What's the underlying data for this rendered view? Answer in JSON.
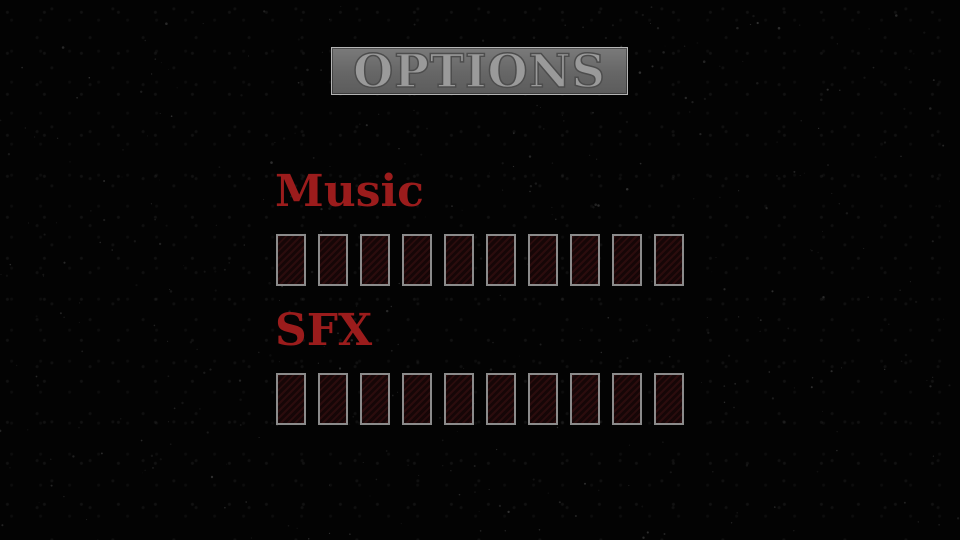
{
  "screen": {
    "title": "OPTIONS"
  },
  "settings": [
    {
      "id": "music",
      "label": "Music",
      "level": 0,
      "notches": 10
    },
    {
      "id": "sfx",
      "label": "SFX",
      "level": 0,
      "notches": 10
    }
  ],
  "colors": {
    "background": "#030303",
    "label": "#9b1c1c",
    "banner": "#6b6b6b",
    "banner_border": "#b5b5b5",
    "notch_border": "#8b8b8b",
    "notch_empty": "#160607",
    "notch_filled": "#7a1414"
  }
}
